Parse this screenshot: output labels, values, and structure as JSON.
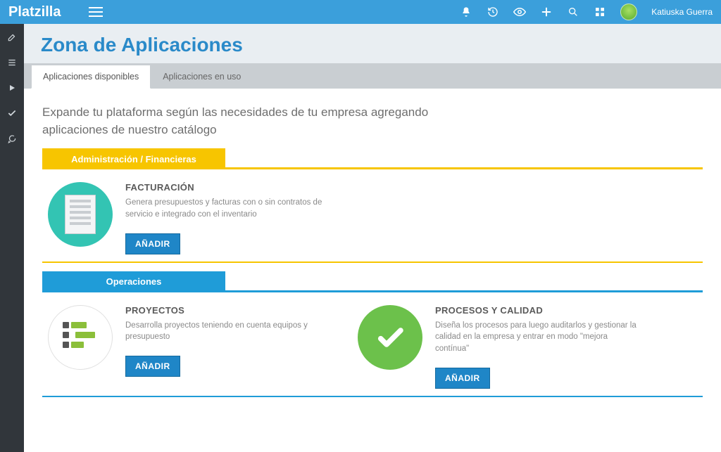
{
  "brand": "Platzilla",
  "user": {
    "name": "Katiuska Guerra"
  },
  "page": {
    "title": "Zona de Aplicaciones"
  },
  "tabs": {
    "available": "Aplicaciones disponibles",
    "inuse": "Aplicaciones en uso"
  },
  "intro": "Expande tu plataforma según las necesidades de tu empresa agregando aplicaciones de nuestro catálogo",
  "buttons": {
    "add": "AÑADIR"
  },
  "categories": [
    {
      "key": "adminfin",
      "title": "Administración / Financieras",
      "color": "yellow",
      "apps": [
        {
          "key": "facturacion",
          "title": "FACTURACIÓN",
          "desc": "Genera presupuestos y facturas con o sin contratos de servicio e integrado con el inventario",
          "icon": "invoice"
        }
      ]
    },
    {
      "key": "operaciones",
      "title": "Operaciones",
      "color": "blue",
      "apps": [
        {
          "key": "proyectos",
          "title": "PROYECTOS",
          "desc": "Desarrolla proyectos teniendo en cuenta equipos y presupuesto",
          "icon": "gantt"
        },
        {
          "key": "procesos",
          "title": "PROCESOS Y CALIDAD",
          "desc": "Diseña los procesos para luego auditarlos y gestionar la calidad en la empresa y entrar en modo \"mejora contínua\"",
          "icon": "check"
        }
      ]
    }
  ]
}
